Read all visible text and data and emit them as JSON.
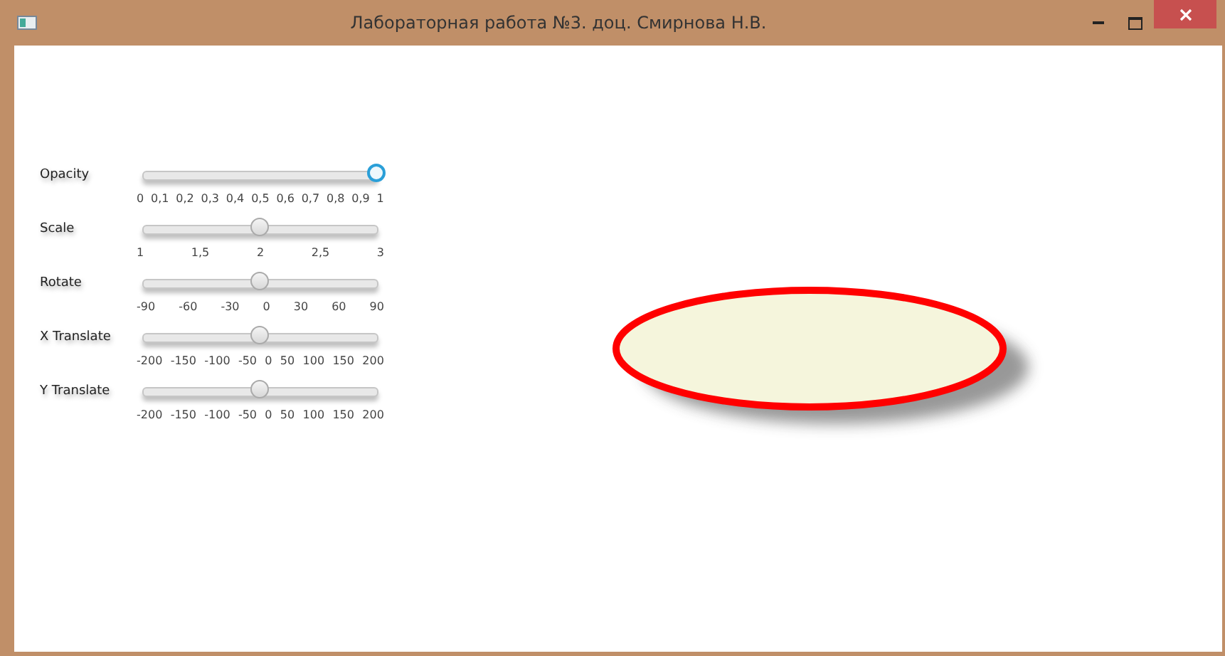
{
  "window": {
    "title": "Лабораторная работа №3. доц. Смирнова Н.В."
  },
  "sliders": [
    {
      "label": "Opacity",
      "level": 1,
      "focused": true,
      "ticks": [
        "0",
        "0,1",
        "0,2",
        "0,3",
        "0,4",
        "0,5",
        "0,6",
        "0,7",
        "0,8",
        "0,9",
        "1"
      ]
    },
    {
      "label": "Scale",
      "level": 0.5,
      "focused": false,
      "ticks": [
        "1",
        "1,5",
        "2",
        "2,5",
        "3"
      ]
    },
    {
      "label": "Rotate",
      "level": 0.5,
      "focused": false,
      "ticks": [
        "-90",
        "-60",
        "-30",
        "0",
        "30",
        "60",
        "90"
      ]
    },
    {
      "label": "X Translate",
      "level": 0.5,
      "focused": false,
      "ticks": [
        "-200",
        "-150",
        "-100",
        "-50",
        "0",
        "50",
        "100",
        "150",
        "200"
      ]
    },
    {
      "label": "Y Translate",
      "level": 0.5,
      "focused": false,
      "ticks": [
        "-200",
        "-150",
        "-100",
        "-50",
        "0",
        "50",
        "100",
        "150",
        "200"
      ]
    }
  ]
}
